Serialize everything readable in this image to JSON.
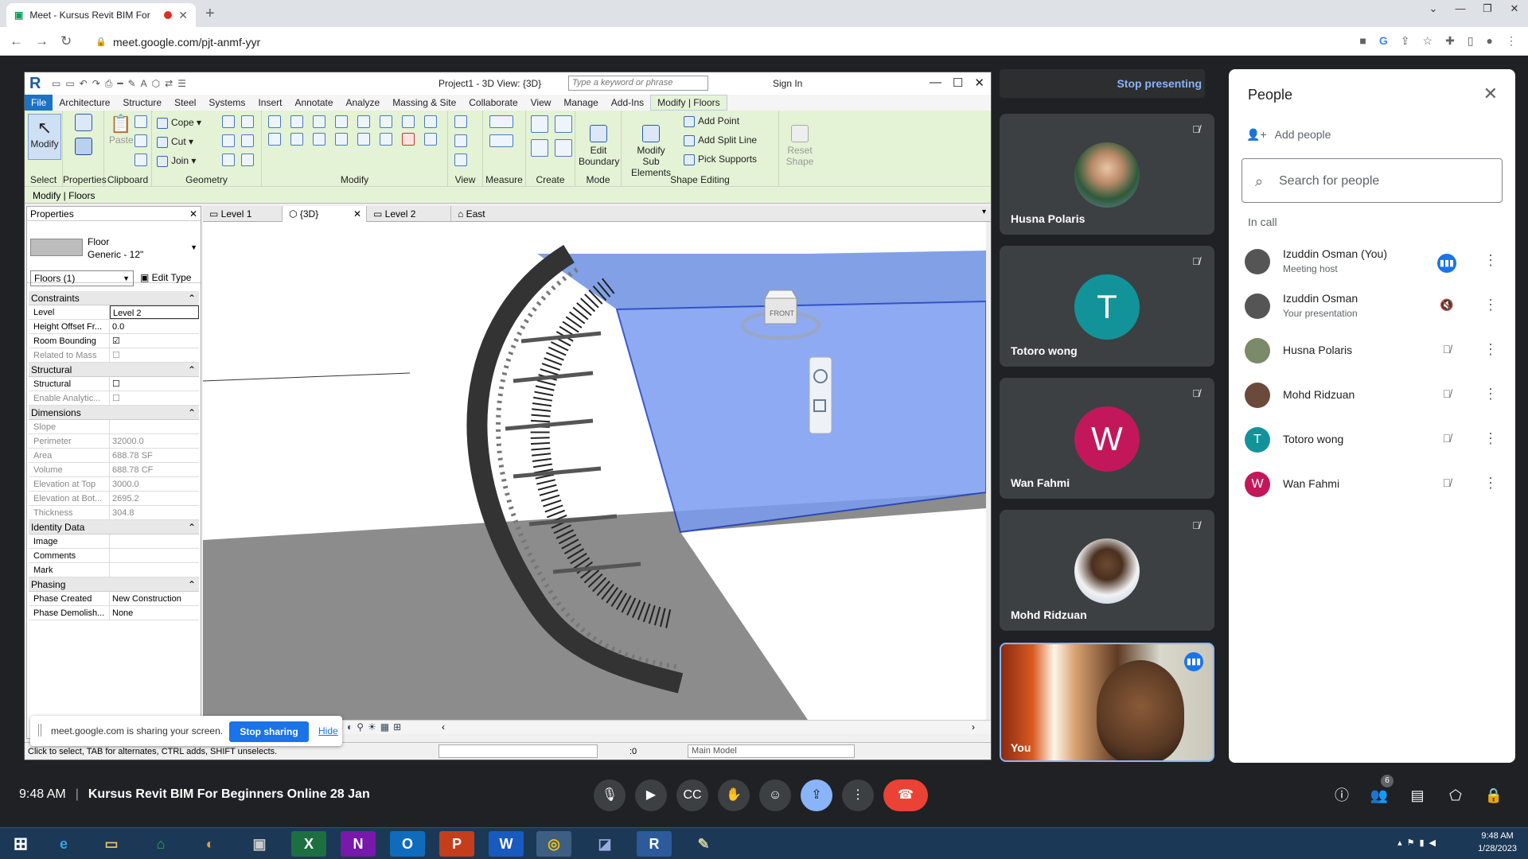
{
  "browser": {
    "tab_title": "Meet - Kursus Revit BIM For",
    "url": "meet.google.com/pjt-anmf-yyr"
  },
  "revit": {
    "project_title": "Project1 - 3D View: {3D}",
    "keyword_placeholder": "Type a keyword or phrase",
    "sign_in": "Sign In",
    "menu": [
      "File",
      "Architecture",
      "Structure",
      "Steel",
      "Systems",
      "Insert",
      "Annotate",
      "Analyze",
      "Massing & Site",
      "Collaborate",
      "View",
      "Manage",
      "Add-Ins",
      "Modify | Floors"
    ],
    "ribbon": {
      "modify": "Modify",
      "properties": "Properties",
      "paste": "Paste",
      "cope": "Cope",
      "cut": "Cut",
      "join": "Join",
      "edit_boundary": "Edit\nBoundary",
      "modify_sub": "Modify\nSub Elements",
      "add_point": "Add Point",
      "add_split": "Add Split Line",
      "pick_supports": "Pick Supports",
      "reset_shape": "Reset\nShape",
      "groups": [
        "Select",
        "Properties",
        "Clipboard",
        "Geometry",
        "Modify",
        "View",
        "Measure",
        "Create",
        "Mode",
        "Shape Editing"
      ]
    },
    "context_label": "Modify | Floors",
    "properties": {
      "header": "Properties",
      "type_line1": "Floor",
      "type_line2": "Generic - 12\"",
      "selector": "Floors (1)",
      "edit_type": "Edit Type",
      "sections": [
        {
          "name": "Constraints",
          "rows": [
            [
              "Level",
              "Level 2"
            ],
            [
              "Height Offset Fr...",
              "0.0"
            ],
            [
              "Room Bounding",
              "☑"
            ],
            [
              "Related to Mass",
              "☐"
            ]
          ]
        },
        {
          "name": "Structural",
          "rows": [
            [
              "Structural",
              "☐"
            ],
            [
              "Enable Analytic...",
              "☐"
            ]
          ]
        },
        {
          "name": "Dimensions",
          "rows": [
            [
              "Slope",
              ""
            ],
            [
              "Perimeter",
              "32000.0"
            ],
            [
              "Area",
              "688.78 SF"
            ],
            [
              "Volume",
              "688.78 CF"
            ],
            [
              "Elevation at Top",
              "3000.0"
            ],
            [
              "Elevation at Bot...",
              "2695.2"
            ],
            [
              "Thickness",
              "304.8"
            ]
          ]
        },
        {
          "name": "Identity Data",
          "rows": [
            [
              "Image",
              ""
            ],
            [
              "Comments",
              ""
            ],
            [
              "Mark",
              ""
            ]
          ]
        },
        {
          "name": "Phasing",
          "rows": [
            [
              "Phase Created",
              "New Construction"
            ],
            [
              "Phase Demolish...",
              "None"
            ]
          ]
        }
      ]
    },
    "view_tabs": [
      "Level 1",
      "{3D}",
      "Level 2",
      "East"
    ],
    "viewcube_label": "FRONT",
    "status_message": "Click to select, TAB for alternates, CTRL adds, SHIFT unselects.",
    "zoom_value": ":0",
    "main_model": "Main Model"
  },
  "sharing": {
    "message": "meet.google.com is sharing your screen.",
    "stop_sharing": "Stop sharing",
    "hide": "Hide"
  },
  "meet": {
    "stop_presenting": "Stop presenting",
    "tiles": [
      {
        "name": "Husna Polaris",
        "initial": "",
        "color": ""
      },
      {
        "name": "Totoro wong",
        "initial": "T",
        "color": "#12939a"
      },
      {
        "name": "Wan Fahmi",
        "initial": "W",
        "color": "#c2185b"
      },
      {
        "name": "Mohd Ridzuan",
        "initial": "",
        "color": ""
      }
    ],
    "you_label": "You",
    "time": "9:48 AM",
    "meeting_title": "Kursus Revit BIM For Beginners Online 28 Jan",
    "people_count": "6"
  },
  "people": {
    "title": "People",
    "add_people": "Add people",
    "search_placeholder": "Search for people",
    "in_call": "In call",
    "list": [
      {
        "name": "Izuddin Osman (You)",
        "sub": "Meeting host",
        "initial": "",
        "color": "#555"
      },
      {
        "name": "Izuddin Osman",
        "sub": "Your presentation",
        "initial": "",
        "color": "#555"
      },
      {
        "name": "Husna Polaris",
        "sub": "",
        "initial": "",
        "color": "#7a8a6a"
      },
      {
        "name": "Mohd Ridzuan",
        "sub": "",
        "initial": "",
        "color": "#6a4a3a"
      },
      {
        "name": "Totoro wong",
        "sub": "",
        "initial": "T",
        "color": "#12939a"
      },
      {
        "name": "Wan Fahmi",
        "sub": "",
        "initial": "W",
        "color": "#c2185b"
      }
    ]
  },
  "taskbar": {
    "time": "9:48 AM",
    "date": "1/28/2023"
  }
}
